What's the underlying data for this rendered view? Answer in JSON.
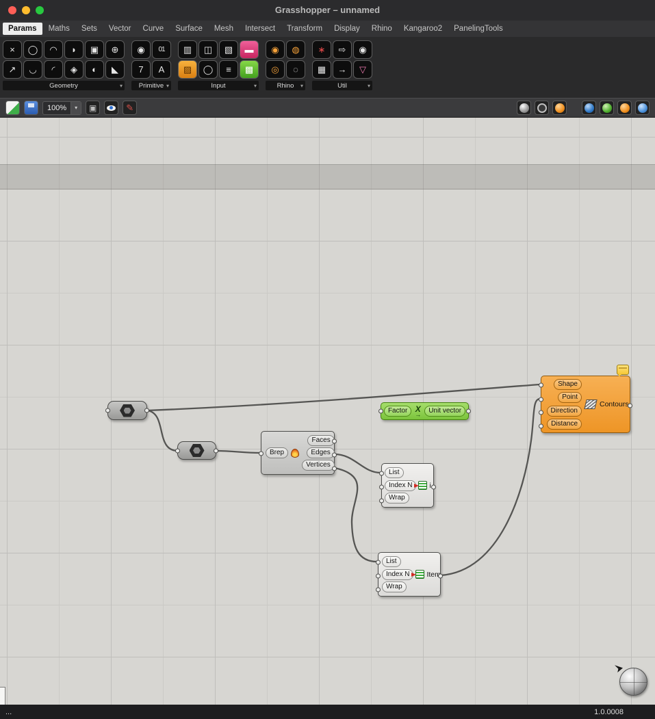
{
  "ui": {
    "caret": "▾"
  },
  "title_bar": {
    "title": "Grasshopper – unnamed"
  },
  "menu": {
    "tabs": [
      "Params",
      "Maths",
      "Sets",
      "Vector",
      "Curve",
      "Surface",
      "Mesh",
      "Intersect",
      "Transform",
      "Display",
      "Rhino",
      "Kangaroo2",
      "PanelingTools"
    ],
    "active_tab": "Params"
  },
  "ribbon": {
    "groups": [
      {
        "label": "Geometry",
        "icons": [
          {
            "name": "null-param",
            "glyph": "×"
          },
          {
            "name": "circle-param",
            "glyph": "◯"
          },
          {
            "name": "arc-param",
            "glyph": "◠"
          },
          {
            "name": "curve-param",
            "glyph": "◗"
          },
          {
            "name": "box-param",
            "glyph": "▣"
          },
          {
            "name": "sphere-param",
            "glyph": "⊕"
          },
          {
            "name": "vector-param",
            "glyph": "↗"
          },
          {
            "name": "interp-curve-param",
            "glyph": "◡"
          },
          {
            "name": "arc3pt-param",
            "glyph": "◜"
          },
          {
            "name": "surface-param",
            "glyph": "◈"
          },
          {
            "name": "geometry-param",
            "glyph": "◐"
          },
          {
            "name": "mesh-param",
            "glyph": "◣"
          }
        ]
      },
      {
        "label": "Primitive",
        "icons": [
          {
            "name": "boolean-param",
            "glyph": "◉"
          },
          {
            "name": "binary-param",
            "glyph": "01"
          },
          {
            "name": "integer-param",
            "glyph": "7"
          },
          {
            "name": "text-param",
            "glyph": "A"
          }
        ]
      },
      {
        "label": "Input",
        "icons": [
          {
            "name": "gene-pool",
            "glyph": "▥"
          },
          {
            "name": "control-knob",
            "glyph": "◫"
          },
          {
            "name": "number-slider",
            "glyph": "▧"
          },
          {
            "name": "panel",
            "glyph": "▬"
          },
          {
            "name": "gradient",
            "glyph": "▨"
          },
          {
            "name": "boolean-toggle",
            "glyph": "◯"
          },
          {
            "name": "value-list",
            "glyph": "≡"
          },
          {
            "name": "colour-swatch",
            "glyph": "▩"
          }
        ]
      },
      {
        "label": "Rhino",
        "icons": [
          {
            "name": "candy",
            "glyph": "◉"
          },
          {
            "name": "honeycomb",
            "glyph": "◍"
          },
          {
            "name": "donut",
            "glyph": "◎"
          },
          {
            "name": "cookie",
            "glyph": "◌"
          }
        ]
      },
      {
        "label": "Util",
        "icons": [
          {
            "name": "cherries",
            "glyph": "∗"
          },
          {
            "name": "import-arrow",
            "glyph": "⇨"
          },
          {
            "name": "cluster",
            "glyph": "◉"
          },
          {
            "name": "data-recorder",
            "glyph": "▦"
          },
          {
            "name": "export-arrow",
            "glyph": "→"
          },
          {
            "name": "flask",
            "glyph": "▽"
          }
        ]
      }
    ]
  },
  "toolbar2": {
    "zoom": "100%"
  },
  "canvas": {
    "unit_vector": {
      "input": "Factor",
      "icon": "X",
      "icon_arrow": "→",
      "output": "Unit vector"
    },
    "deconstruct_brep": {
      "input": "Brep",
      "outputs": [
        "Faces",
        "Edges",
        "Vertices"
      ]
    },
    "list_item_1": {
      "inputs": [
        "List",
        "Index N",
        "Wrap"
      ],
      "output": "i"
    },
    "list_item_2": {
      "inputs": [
        "List",
        "Index N",
        "Wrap"
      ],
      "output": "Item"
    },
    "contour": {
      "inputs": [
        "Shape",
        "Point",
        "Direction",
        "Distance"
      ],
      "output": "Contours"
    }
  },
  "status_bar": {
    "left": "...",
    "right": "1.0.0008"
  }
}
